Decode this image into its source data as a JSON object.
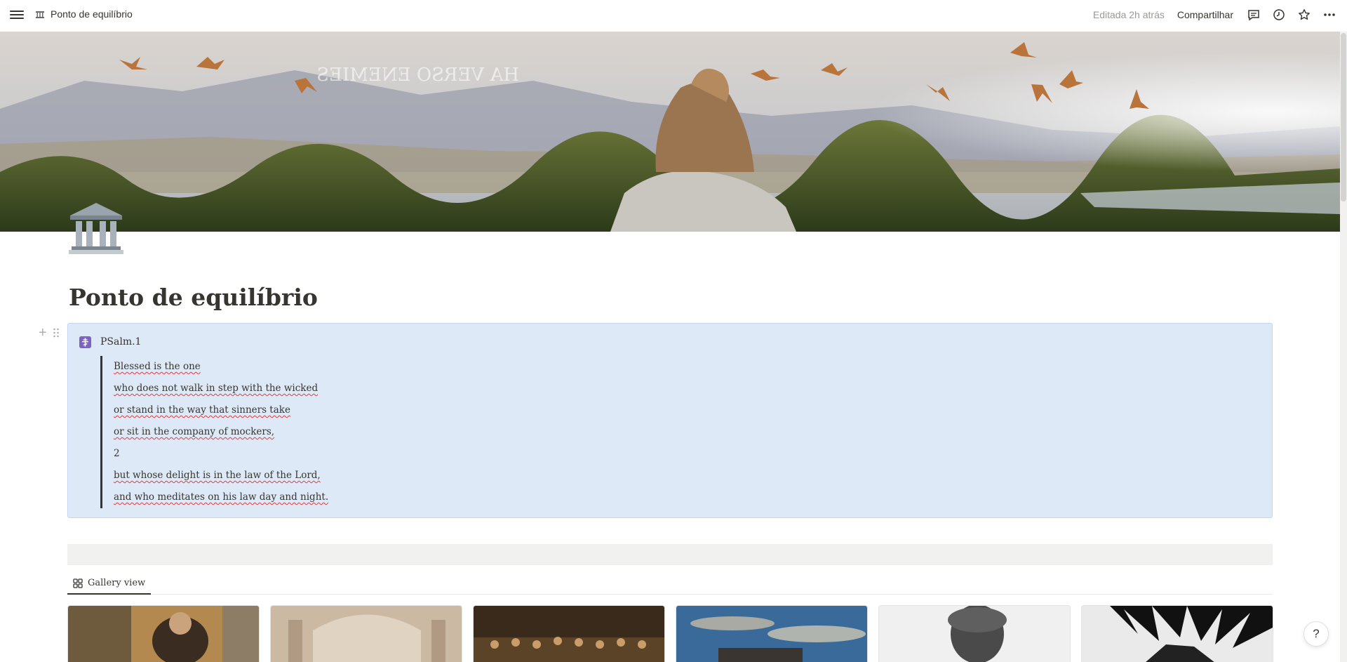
{
  "topbar": {
    "breadcrumb": "Ponto de equilíbrio",
    "edited": "Editada 2h atrás",
    "share": "Compartilhar",
    "icons": [
      "menu-icon",
      "comment-icon",
      "clock-icon",
      "star-icon",
      "more-icon"
    ]
  },
  "page": {
    "title": "Ponto de equilíbrio",
    "icon": "classical-building-icon",
    "cover_text": "HA VERSO ENEMIES"
  },
  "callout": {
    "icon": "orthodox-cross-icon",
    "title": "PSalm.1",
    "lines": [
      "Blessed is the one",
      "who does not walk in step with the wicked",
      "or stand in the way that sinners take",
      "or sit in the company of mockers,",
      "2",
      "but whose delight is in the law of the Lord,",
      "and who meditates on his law day and night."
    ]
  },
  "database": {
    "view_label": "Gallery view",
    "view_icon": "gallery-icon",
    "cards": [
      {
        "name": "gallery-card-painting-saint"
      },
      {
        "name": "gallery-card-school-of-athens"
      },
      {
        "name": "gallery-card-last-supper"
      },
      {
        "name": "gallery-card-sky-ruins"
      },
      {
        "name": "gallery-card-marble-bust"
      },
      {
        "name": "gallery-card-manga-sketch"
      }
    ]
  },
  "help": {
    "label": "?"
  },
  "colors": {
    "callout_bg": "#dde9f7",
    "text": "#37352f",
    "muted": "#9b9a97",
    "accent_purple": "#7e62c1"
  }
}
